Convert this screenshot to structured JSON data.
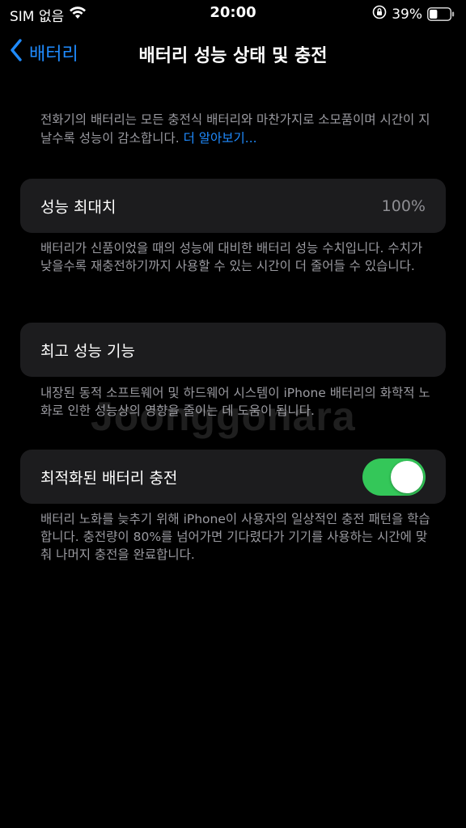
{
  "status_bar": {
    "carrier": "SIM 없음",
    "time": "20:00",
    "battery_percent": "39%",
    "battery_level": 0.39,
    "icons": [
      "wifi-icon",
      "orientation-lock-icon",
      "battery-icon"
    ]
  },
  "nav": {
    "back_label": "배터리",
    "title": "배터리 성능 상태 및 충전"
  },
  "intro": {
    "text": "전화기의 배터리는 모든 충전식 배터리와 마찬가지로 소모품이며 시간이 지날수록 성능이 감소합니다. ",
    "link": "더 알아보기..."
  },
  "max_capacity": {
    "label": "성능 최대치",
    "value": "100%",
    "footnote": "배터리가 신품이었을 때의 성능에 대비한 배터리 성능 수치입니다. 수치가 낮을수록 재충전하기까지 사용할 수 있는 시간이 더 줄어들 수 있습니다."
  },
  "peak_performance": {
    "label": "최고 성능 기능",
    "footnote": "내장된 동적 소프트웨어 및 하드웨어 시스템이 iPhone 배터리의 화학적 노화로 인한 성능상의 영향을 줄이는 데 도움이 됩니다."
  },
  "optimized_charging": {
    "label": "최적화된 배터리 충전",
    "enabled": true,
    "footnote": "배터리 노화를 늦추기 위해 iPhone이 사용자의 일상적인 충전 패턴을 학습합니다. 충전량이 80%를 넘어가면 기다렸다가 기기를 사용하는 시간에 맞춰 나머지 충전을 완료합니다."
  },
  "watermark": "Joonggonara",
  "colors": {
    "accent": "#1f8bff",
    "toggle_on": "#34c759",
    "cell_bg": "#1c1c1e",
    "secondary_text": "#9a9aa0"
  }
}
